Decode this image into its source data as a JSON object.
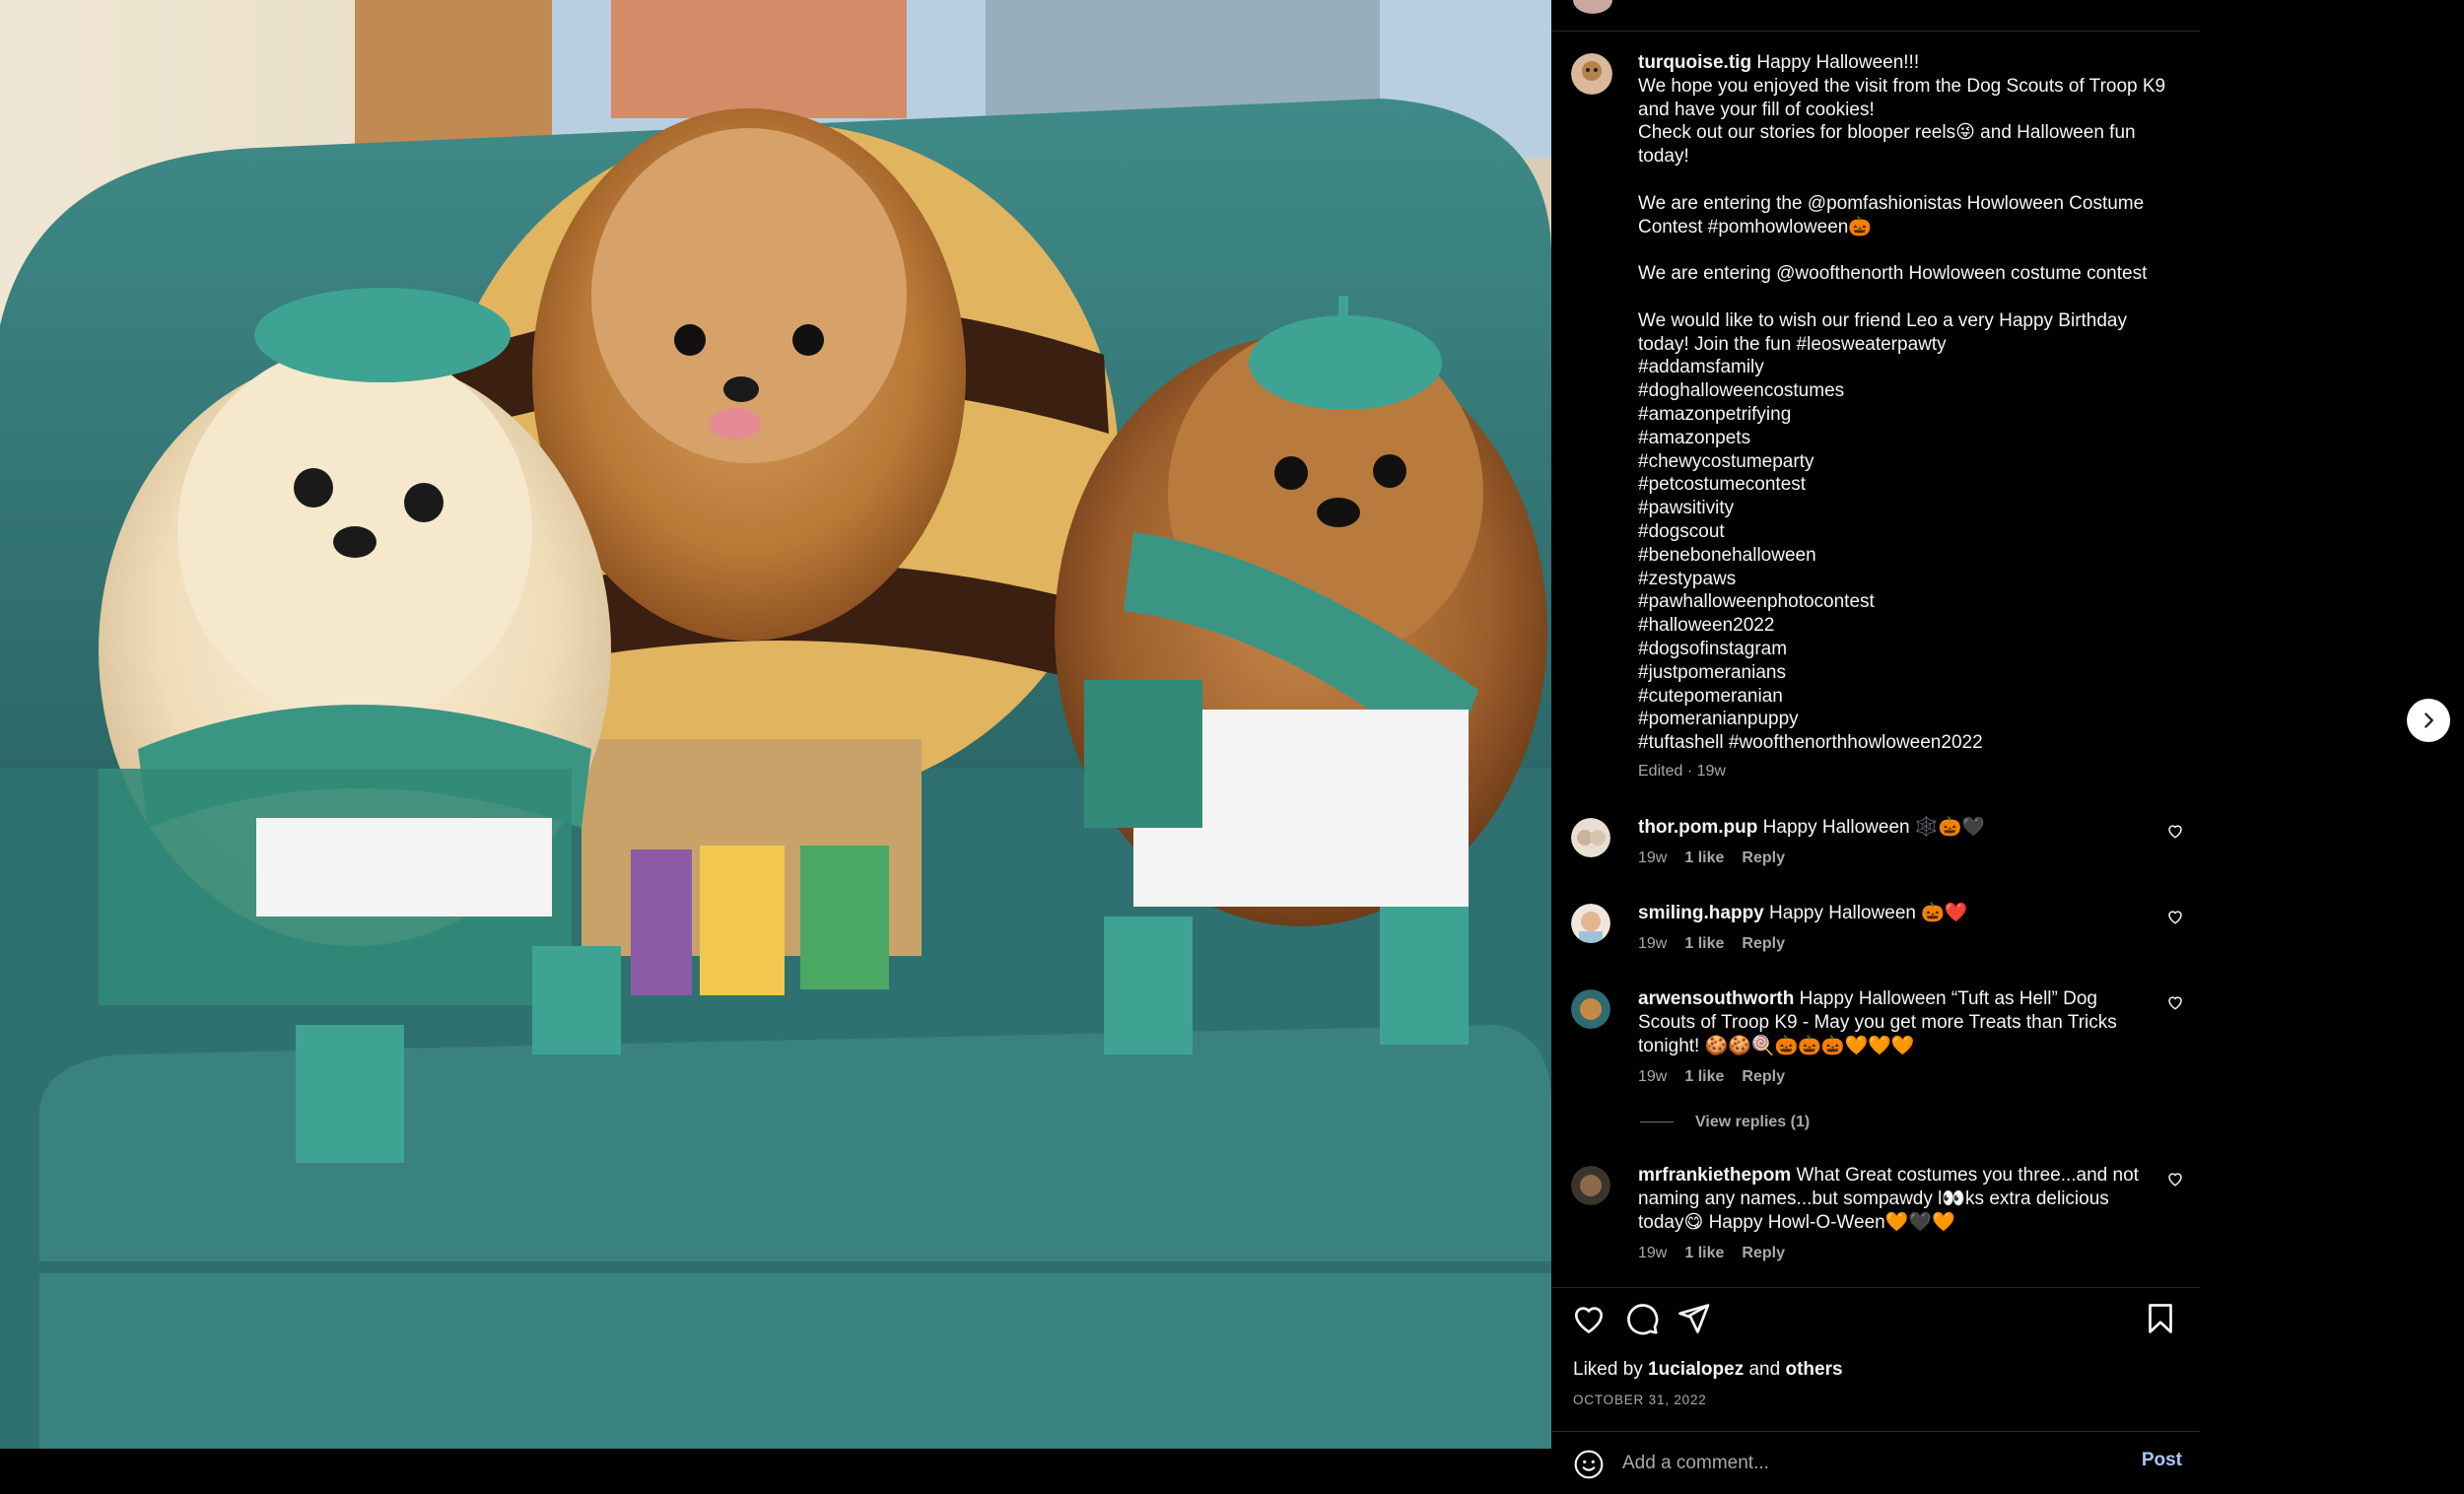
{
  "post": {
    "author": "turquoise.tig",
    "caption": "Happy Halloween!!!\nWe hope you enjoyed the visit from the Dog Scouts of Troop K9 and have your fill of cookies!\nCheck out our stories for blooper reels😜 and Halloween fun today!\n\nWe are entering the @pomfashionistas Howloween Costume Contest #pomhowloween🎃\n\nWe are entering @woofthenorth Howloween costume contest\n\nWe would like to wish our friend Leo a very Happy Birthday today! Join the fun #leosweaterpawty\n#addamsfamily\n#doghalloweencostumes\n#amazonpetrifying\n#amazonpets\n#chewycostumeparty\n#petcostumecontest\n#pawsitivity\n#dogscout\n#benebonehalloween\n#zestypaws\n#pawhalloweenphotocontest\n#halloween2022\n#dogsofinstagram\n#justpomeranians\n#cutepomeranian\n#pomeranianpuppy\n#tuftashell #woofthenorthhowloween2022",
    "caption_meta": "Edited · 19w"
  },
  "comments": [
    {
      "user": "thor.pom.pup",
      "text": "Happy Halloween 🕸️🎃🖤",
      "time": "19w",
      "likes": "1 like",
      "reply": "Reply"
    },
    {
      "user": "smiling.happy",
      "text": "Happy Halloween 🎃❤️",
      "time": "19w",
      "likes": "1 like",
      "reply": "Reply"
    },
    {
      "user": "arwensouthworth",
      "text": "Happy Halloween “Tuft as Hell” Dog Scouts of Troop K9 - May you get more Treats than Tricks tonight! 🍪🍪🍭🎃🎃🎃🧡🧡🧡",
      "time": "19w",
      "likes": "1 like",
      "reply": "Reply"
    },
    {
      "user": "mrfrankiethepom",
      "text": "What Great costumes you three...and not naming any names...but sompawdy l👀ks extra delicious today😋 Happy Howl-O-Ween🧡🖤🧡",
      "time": "19w",
      "likes": "1 like",
      "reply": "Reply"
    }
  ],
  "view_replies": "View replies (1)",
  "likes": {
    "prefix": "Liked by ",
    "user": "1ucialopez",
    "middle": " and ",
    "others": "others"
  },
  "date": "OCTOBER 31, 2022",
  "comment_input": {
    "placeholder": "Add a comment..."
  },
  "post_button": "Post",
  "icons": {
    "like": "heart-icon",
    "comment": "comment-bubble-icon",
    "share": "paper-plane-icon",
    "save": "bookmark-icon",
    "emoji": "smiley-icon",
    "next": "chevron-right-icon"
  },
  "colors": {
    "background": "#000000",
    "text": "#f5f5f5",
    "muted": "#a8a8a8",
    "link": "#a8c7fa",
    "divider": "#262626"
  }
}
